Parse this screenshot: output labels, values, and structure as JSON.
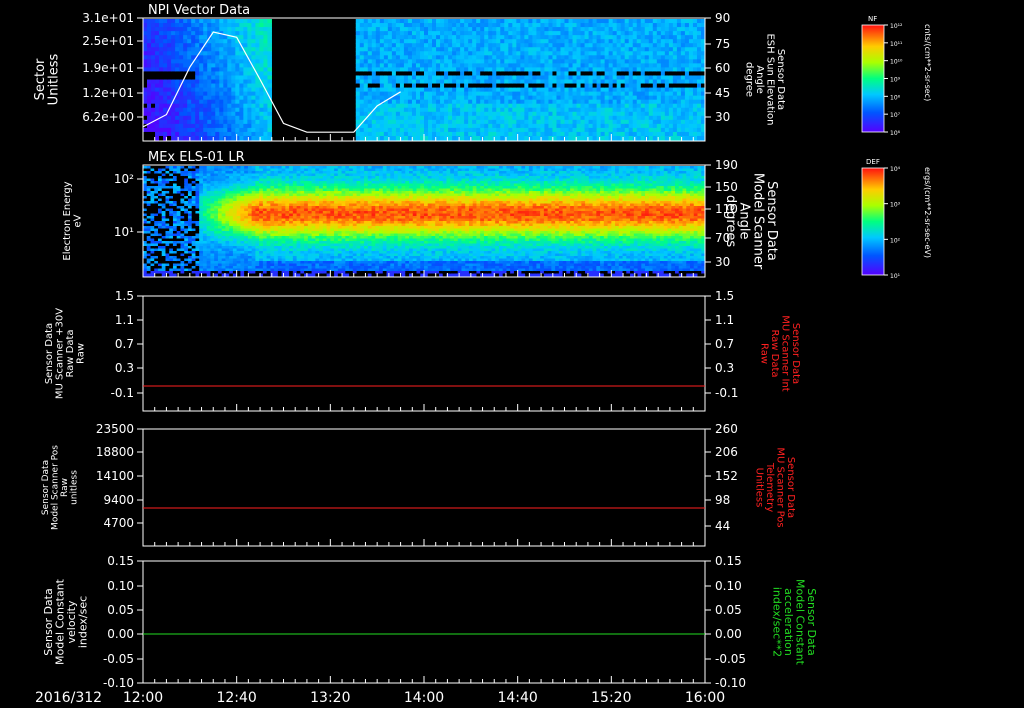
{
  "date_label": "2016/312",
  "time_ticks": [
    "12:00",
    "12:40",
    "13:20",
    "14:00",
    "14:40",
    "15:20",
    "16:00"
  ],
  "colors": {
    "background": "#000000",
    "axis": "#ffffff",
    "red_series": "#ff2020",
    "green_series": "#22dd22",
    "sun_curve": "#ffffff"
  },
  "panels": [
    {
      "id": "npi",
      "title": "NPI Vector Data",
      "left_label": [
        "Sector",
        "Unitless"
      ],
      "left_ticks": [
        "3.1e+01",
        "2.5e+01",
        "1.9e+01",
        "1.2e+01",
        "6.2e+00"
      ],
      "right_label": [
        "Sensor Data",
        "ESH Sun Elevation",
        "Angle",
        "degree"
      ],
      "right_ticks": [
        "90",
        "75",
        "60",
        "45",
        "30"
      ],
      "colorbar": {
        "tag": "NF",
        "unit": "cnts/(cm**2-sr-sec)",
        "ticks": [
          "10¹²",
          "10¹¹",
          "10¹⁰",
          "10⁹",
          "10⁸",
          "10⁷",
          "10⁶"
        ]
      }
    },
    {
      "id": "els",
      "title": "MEx ELS-01 LR",
      "left_label": [
        "Electron Energy",
        "eV"
      ],
      "left_ticks": [
        "10²",
        "10¹"
      ],
      "right_label": [
        "Sensor Data",
        "Model Scanner",
        "Angle",
        "degrees"
      ],
      "right_ticks": [
        "190",
        "150",
        "110",
        "70",
        "30"
      ],
      "colorbar": {
        "tag": "DEF",
        "unit": "ergs/(cm**2-sr-sec-eV)",
        "ticks": [
          "10⁴",
          "10³",
          "10²",
          "10¹"
        ]
      }
    },
    {
      "id": "mu30",
      "left_label": [
        "Sensor Data",
        "MU Scanner +30V",
        "Raw Data",
        "Raw"
      ],
      "left_ticks": [
        "1.5",
        "1.1",
        "0.7",
        "0.3",
        "-0.1"
      ],
      "right_label": [
        "Sensor Data",
        "MU Scanner Int",
        "Raw Data",
        "Raw"
      ],
      "right_ticks": [
        "1.5",
        "1.1",
        "0.7",
        "0.3",
        "-0.1"
      ]
    },
    {
      "id": "pos",
      "left_label": [
        "Sensor Data",
        "Model Scanner Pos",
        "Raw",
        "unitless"
      ],
      "left_ticks": [
        "23500",
        "18800",
        "14100",
        "9400",
        "4700"
      ],
      "right_label": [
        "Sensor Data",
        "MU Scanner Pos",
        "Telemetry",
        "Unitless"
      ],
      "right_ticks": [
        "260",
        "206",
        "152",
        "98",
        "44"
      ]
    },
    {
      "id": "vel",
      "left_label": [
        "Sensor Data",
        "Model Constant",
        "velocity",
        "index/sec"
      ],
      "left_ticks": [
        "0.15",
        "0.10",
        "0.05",
        "0.00",
        "-0.05",
        "-0.10"
      ],
      "right_label": [
        "Sensor Data",
        "Model Constant",
        "acceleration",
        "index/sec**2"
      ],
      "right_ticks": [
        "0.15",
        "0.10",
        "0.05",
        "0.00",
        "-0.05",
        "-0.10"
      ]
    }
  ],
  "chart_data": [
    {
      "type": "heatmap",
      "panel": "npi",
      "title": "NPI Vector Data",
      "ylabel": "Sector Unitless",
      "xlim": [
        "12:00",
        "16:00"
      ],
      "data_gap": [
        "12:55",
        "13:30"
      ],
      "overlay_line": {
        "name": "ESH Sun Elevation Angle",
        "axis": "right",
        "ylim": [
          20,
          90
        ],
        "x": [
          "12:00",
          "12:10",
          "12:20",
          "12:30",
          "12:40",
          "12:50",
          "13:00",
          "13:10",
          "13:20",
          "13:30",
          "13:40",
          "13:50"
        ],
        "y": [
          28,
          35,
          62,
          82,
          79,
          55,
          30,
          25,
          25,
          25,
          40,
          48
        ]
      }
    },
    {
      "type": "heatmap",
      "panel": "els",
      "title": "MEx ELS-01 LR",
      "ylabel": "Electron Energy eV",
      "xlim": [
        "12:00",
        "16:00"
      ]
    },
    {
      "type": "line",
      "panel": "mu30",
      "ylim": [
        -0.3,
        1.5
      ],
      "series": [
        {
          "name": "MU Scanner Int Raw Data",
          "x": [
            "12:00",
            "16:00"
          ],
          "y": [
            -0.1,
            -0.1
          ]
        }
      ]
    },
    {
      "type": "line",
      "panel": "pos",
      "ylim": [
        0,
        23500
      ],
      "series": [
        {
          "name": "MU Scanner Pos Telemetry",
          "axis": "right",
          "x": [
            "12:00",
            "16:00"
          ],
          "y": [
            98,
            98
          ]
        }
      ]
    },
    {
      "type": "line",
      "panel": "vel",
      "ylim": [
        -0.1,
        0.15
      ],
      "series": [
        {
          "name": "Model Constant acceleration",
          "axis": "right",
          "x": [
            "12:00",
            "16:00"
          ],
          "y": [
            0.0,
            0.0
          ]
        }
      ]
    }
  ]
}
